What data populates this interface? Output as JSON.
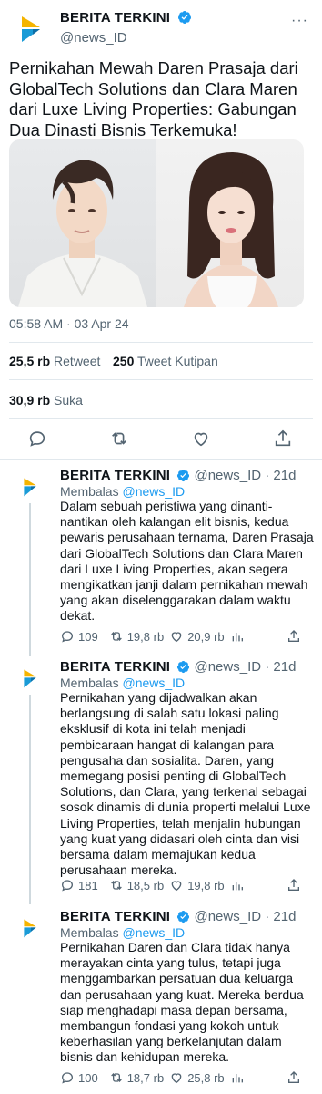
{
  "account": {
    "name": "BERITA TERKINI",
    "handle": "@news_ID"
  },
  "main_tweet": {
    "text": "Pernikahan Mewah Daren Prasaja dari GlobalTech Solutions dan Clara Maren dari Luxe Living Properties: Gabungan Dua Dinasti Bisnis Terkemuka!",
    "timestamp": "05:58 AM · 03 Apr 24",
    "retweets_count": "25,5 rb",
    "retweets_label": "Retweet",
    "quotes_count": "250",
    "quotes_label": "Tweet Kutipan",
    "likes_count": "30,9 rb",
    "likes_label": "Suka"
  },
  "replies": [
    {
      "name": "BERITA TERKINI",
      "handle": "@news_ID",
      "time": "· 21d",
      "replying_prefix": "Membalas",
      "replying_to": "@news_ID",
      "text": "Dalam sebuah peristiwa yang dinanti-nantikan oleh kalangan elit bisnis, kedua pewaris perusahaan ternama, Daren Prasaja dari GlobalTech Solutions dan Clara Maren dari Luxe Living Properties, akan segera mengikatkan janji dalam pernikahan mewah yang akan diselenggarakan dalam waktu dekat.",
      "replies": "109",
      "retweets": "19,8 rb",
      "likes": "20,9 rb"
    },
    {
      "name": "BERITA TERKINI",
      "handle": "@news_ID",
      "time": "· 21d",
      "replying_prefix": "Membalas",
      "replying_to": "@news_ID",
      "text": "Pernikahan yang dijadwalkan akan berlangsung di salah satu lokasi paling eksklusif di kota ini telah menjadi pembicaraan hangat di kalangan para pengusaha dan sosialita. Daren, yang memegang posisi penting di GlobalTech Solutions, dan Clara, yang terkenal sebagai sosok dinamis di dunia properti melalui Luxe Living Properties, telah menjalin hubungan yang kuat yang didasari oleh cinta dan visi bersama dalam memajukan kedua perusahaan mereka.",
      "replies": "181",
      "retweets": "18,5 rb",
      "likes": "19,8 rb"
    },
    {
      "name": "BERITA TERKINI",
      "handle": "@news_ID",
      "time": "· 21d",
      "replying_prefix": "Membalas",
      "replying_to": "@news_ID",
      "text": "Pernikahan Daren dan Clara tidak hanya merayakan cinta yang tulus, tetapi juga menggambarkan persatuan dua keluarga dan perusahaan yang kuat. Mereka berdua siap menghadapi masa depan bersama, membangun fondasi yang kokoh untuk keberhasilan yang berkelanjutan dalam bisnis dan kehidupan mereka.",
      "replies": "100",
      "retweets": "18,7 rb",
      "likes": "25,8 rb"
    }
  ],
  "colors": {
    "accent": "#1d9bf0",
    "logo_yellow": "#f5b400",
    "logo_blue": "#1a9bd7",
    "secondary_text": "#536471"
  }
}
